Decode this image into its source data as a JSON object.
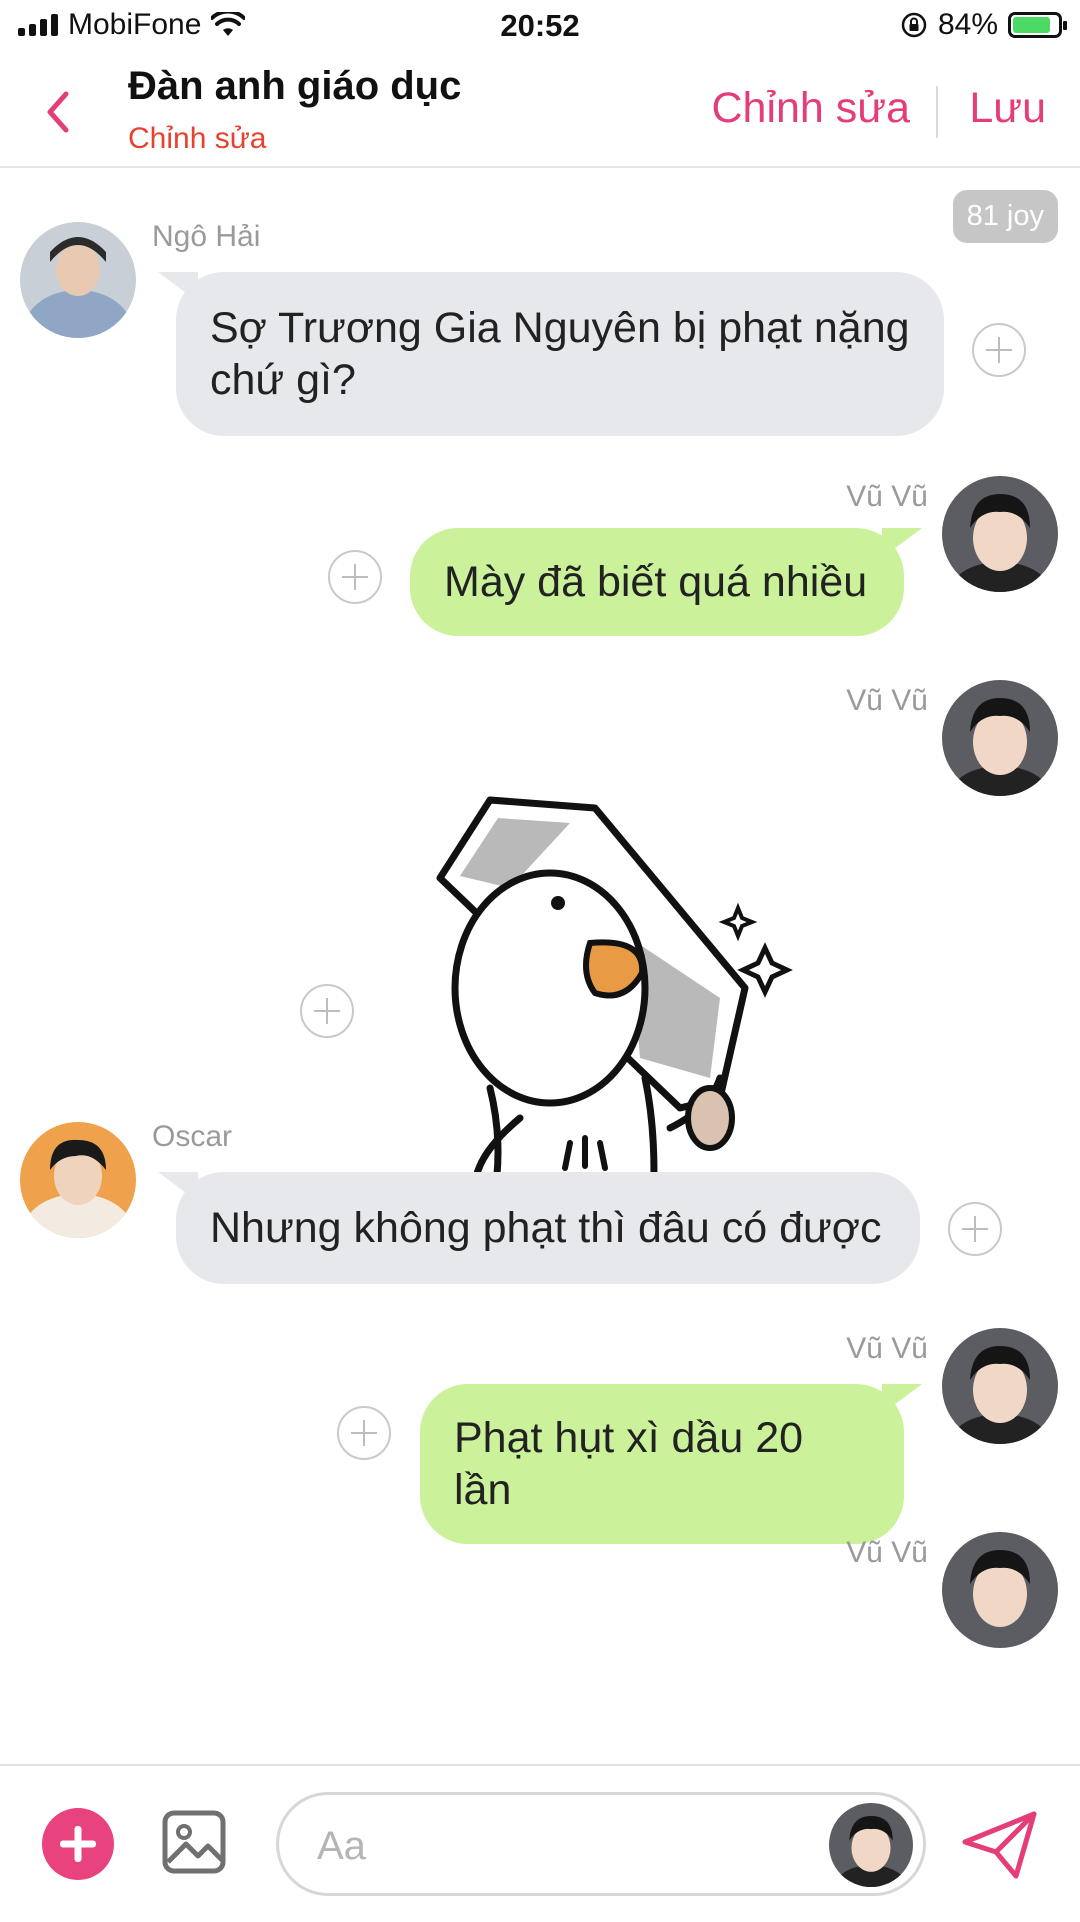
{
  "status_bar": {
    "carrier": "MobiFone",
    "time": "20:52",
    "battery_percent": "84%",
    "battery_level": 0.84
  },
  "header": {
    "title": "Đàn anh giáo dục",
    "subtitle": "Chỉnh sửa",
    "edit_label": "Chỉnh sửa",
    "save_label": "Lưu"
  },
  "chat": {
    "joy_badge": "81 joy",
    "messages": [
      {
        "sender": "Ngô Hải",
        "direction": "in",
        "text": "Sợ Trương Gia Nguyên bị phạt nặng chứ gì?"
      },
      {
        "sender": "Vũ Vũ",
        "direction": "out",
        "text": "Mày đã biết quá nhiều"
      },
      {
        "sender": "Vũ Vũ",
        "direction": "out",
        "type": "sticker",
        "sticker": "duck-with-knife-sticker"
      },
      {
        "sender": "Oscar",
        "direction": "in",
        "text": "Nhưng không phạt thì đâu có được"
      },
      {
        "sender": "Vũ Vũ",
        "direction": "out",
        "text": "Phạt hụt xì dầu 20 lần"
      },
      {
        "sender": "Vũ Vũ",
        "direction": "out",
        "partial": true
      }
    ]
  },
  "composer": {
    "placeholder": "Aa"
  },
  "colors": {
    "accent": "#e53c7a",
    "subtitle": "#e8412e",
    "bubble_in": "#e7e8ec",
    "bubble_out": "#cbf29a"
  },
  "icons": [
    "back-chevron-icon",
    "plus-circle-icon",
    "image-icon",
    "send-icon",
    "wifi-icon",
    "battery-icon",
    "orientation-lock-icon"
  ]
}
